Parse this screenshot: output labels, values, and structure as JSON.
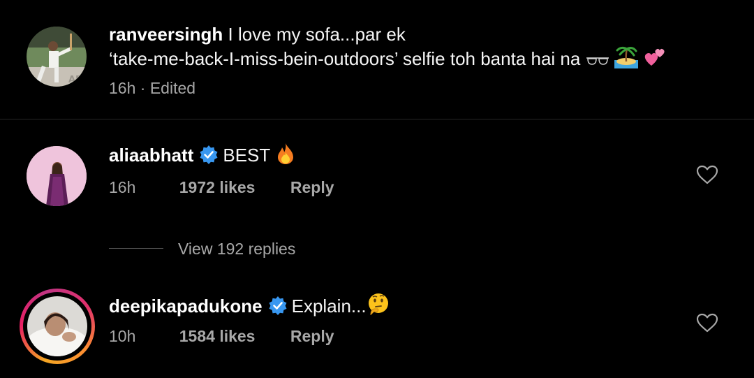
{
  "caption": {
    "username": "ranveersingh",
    "text_line1": "I love my sofa...par ek",
    "text_line2": "‘take-me-back-I-miss-bein-outdoors’ selfie toh banta hai na",
    "emojis": [
      "sunglasses-emoji",
      "island-emoji",
      "two-hearts-emoji"
    ],
    "time": "16h",
    "separator": "·",
    "edited": "Edited"
  },
  "comments": [
    {
      "username": "aliaabhatt",
      "verified": true,
      "text": "BEST",
      "emoji": "fire-emoji",
      "time": "16h",
      "likes": "1972 likes",
      "reply_label": "Reply",
      "view_replies": "View 192 replies"
    },
    {
      "username": "deepikapadukone",
      "verified": true,
      "text": "Explain...",
      "emoji": "thinking-face-emoji",
      "time": "10h",
      "likes": "1584 likes",
      "reply_label": "Reply",
      "has_story_ring": true
    }
  ],
  "colors": {
    "background": "#000000",
    "text_primary": "#ffffff",
    "text_secondary": "#a8a8a8",
    "verified_badge": "#3897f0",
    "divider": "#262626"
  }
}
